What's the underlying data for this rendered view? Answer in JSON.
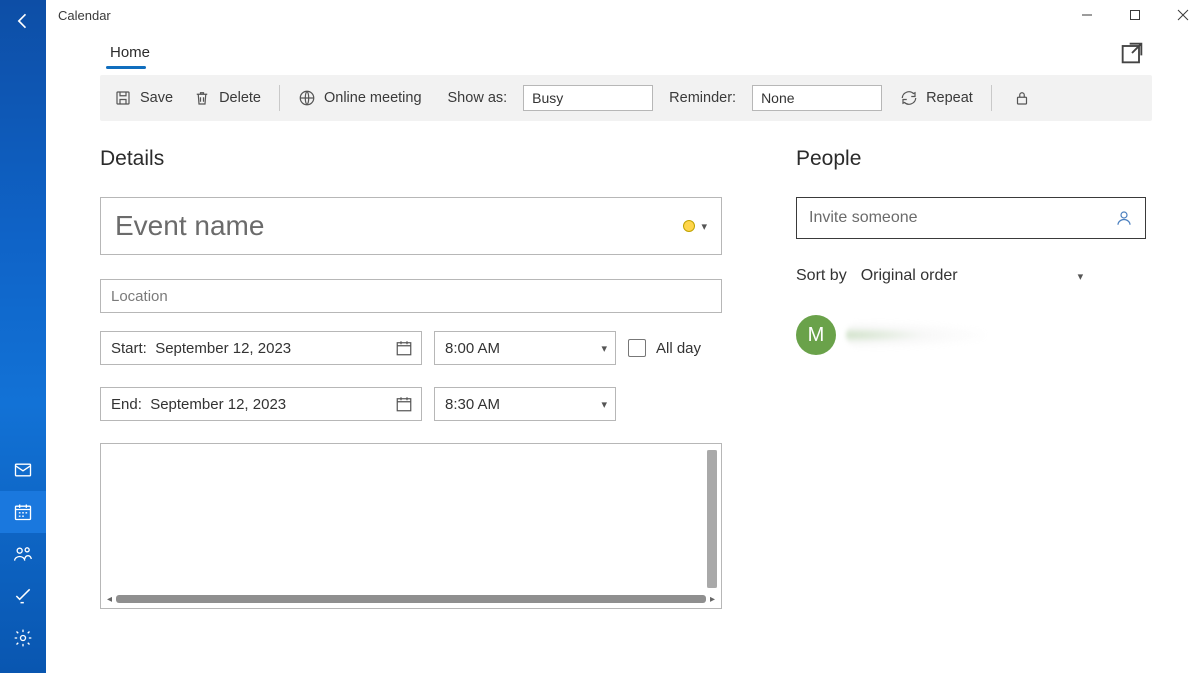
{
  "window": {
    "title": "Calendar"
  },
  "tabs": {
    "home": "Home"
  },
  "toolbar": {
    "save": "Save",
    "delete": "Delete",
    "online_meeting": "Online meeting",
    "show_as_label": "Show as:",
    "show_as_value": "Busy",
    "reminder_label": "Reminder:",
    "reminder_value": "None",
    "repeat": "Repeat"
  },
  "details": {
    "heading": "Details",
    "event_name_placeholder": "Event name",
    "location_placeholder": "Location",
    "start_label": "Start:",
    "start_date": "September 12, 2023",
    "start_time": "8:00 AM",
    "end_label": "End:",
    "end_date": "September 12, 2023",
    "end_time": "8:30 AM",
    "all_day": "All day",
    "description": "",
    "color": "#ffd54a"
  },
  "people": {
    "heading": "People",
    "invite_placeholder": "Invite someone",
    "sort_by_label": "Sort by",
    "sort_by_value": "Original order",
    "attendee_initial": "M"
  }
}
